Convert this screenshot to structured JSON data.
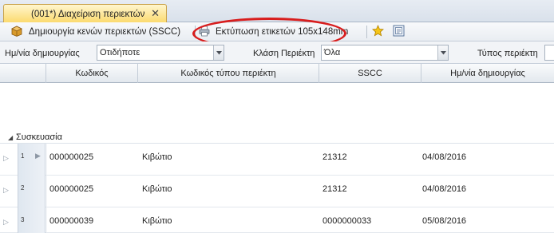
{
  "tab": {
    "title": "(001*) Διαχείριση περιεκτών",
    "close": "✕"
  },
  "toolbar": {
    "create_label": "Δημιουργία κενών περιεκτών (SSCC)",
    "print_label": "Εκτύπωση ετικετών 105x148mm",
    "favorite_icon": "star-icon",
    "document_icon": "document-icon"
  },
  "filters": {
    "date_label": "Ημ/νία δημιουργίας",
    "date_value": "Οτιδήποτε",
    "class_label": "Κλάση Περιέκτη",
    "class_value": "Όλα",
    "type_label": "Τύπος περιέκτη"
  },
  "grid": {
    "columns": [
      "Κωδικός",
      "Κωδικός τύπου περιέκτη",
      "SSCC",
      "Ημ/νία δημιουργίας"
    ],
    "group_label": "Συσκευασία",
    "rows": [
      {
        "num": "1",
        "code": "000000025",
        "type": "Κιβώτιο",
        "sscc": "21312",
        "date": "04/08/2016"
      },
      {
        "num": "2",
        "code": "000000025",
        "type": "Κιβώτιο",
        "sscc": "21312",
        "date": "04/08/2016"
      },
      {
        "num": "3",
        "code": "000000039",
        "type": "Κιβώτιο",
        "sscc": "0000000033",
        "date": "05/08/2016"
      }
    ]
  },
  "colors": {
    "tab_active": "#fbd96b",
    "highlight_oval": "#d81d1d"
  }
}
